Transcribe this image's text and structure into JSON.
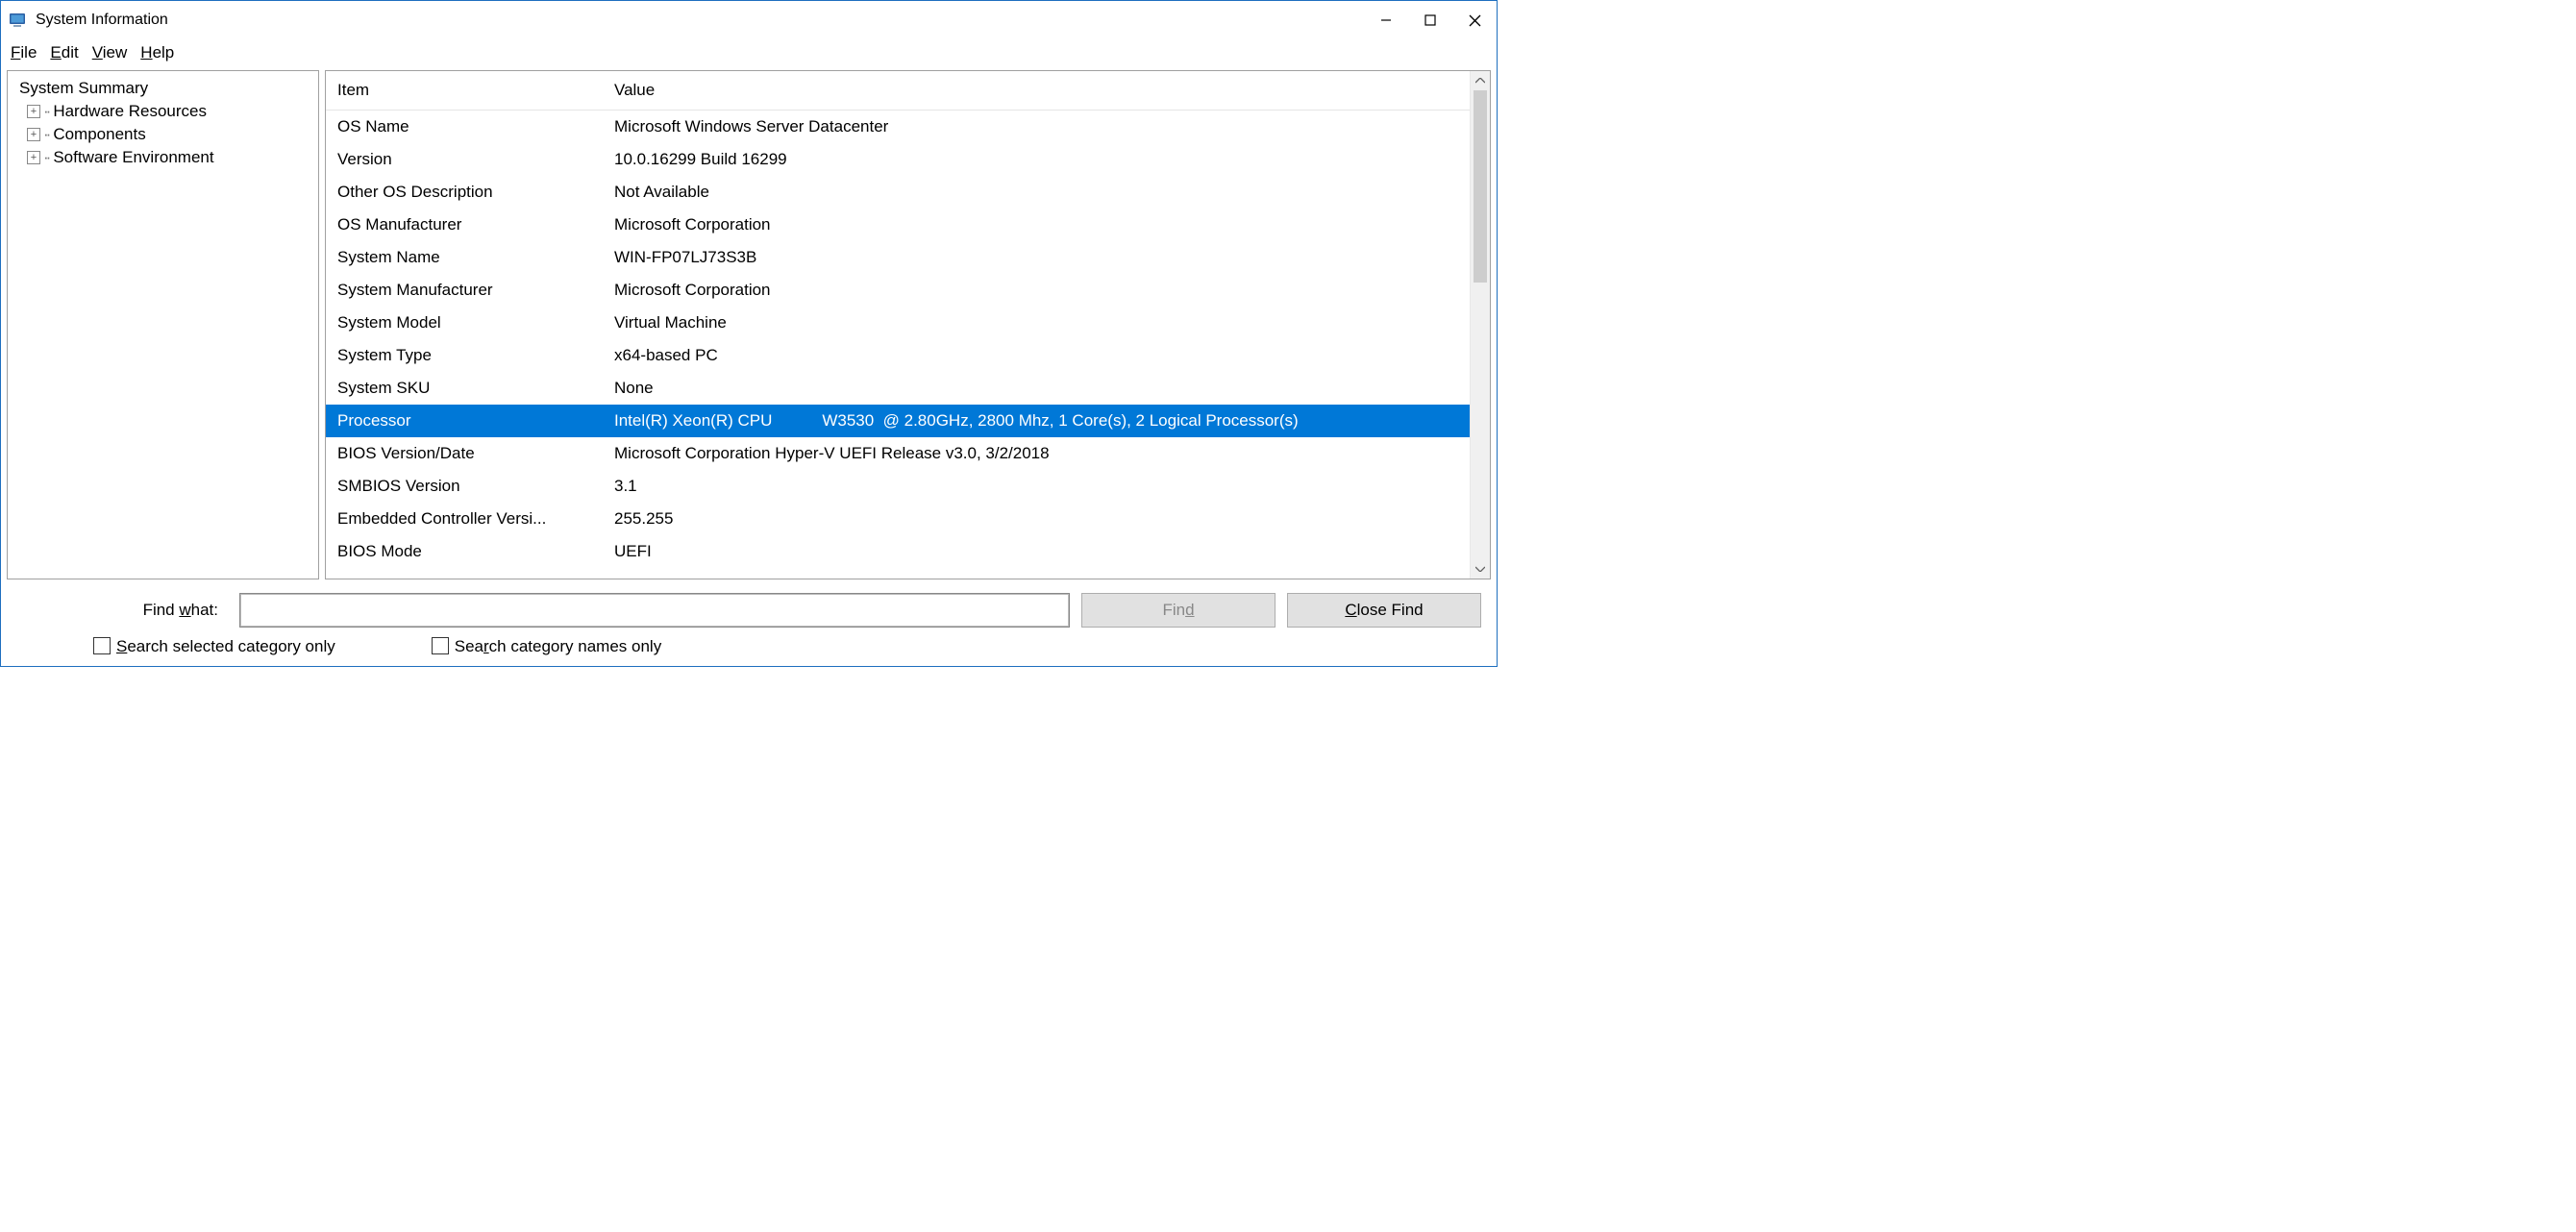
{
  "title": "System Information",
  "menu": {
    "file": "File",
    "edit": "Edit",
    "view": "View",
    "help": "Help"
  },
  "tree": {
    "root": "System Summary",
    "children": [
      "Hardware Resources",
      "Components",
      "Software Environment"
    ]
  },
  "list": {
    "headers": {
      "item": "Item",
      "value": "Value"
    },
    "rows": [
      {
        "item": "OS Name",
        "value": "Microsoft Windows Server Datacenter",
        "selected": false
      },
      {
        "item": "Version",
        "value": "10.0.16299 Build 16299",
        "selected": false
      },
      {
        "item": "Other OS Description",
        "value": "Not Available",
        "selected": false
      },
      {
        "item": "OS Manufacturer",
        "value": "Microsoft Corporation",
        "selected": false
      },
      {
        "item": "System Name",
        "value": "WIN-FP07LJ73S3B",
        "selected": false
      },
      {
        "item": "System Manufacturer",
        "value": "Microsoft Corporation",
        "selected": false
      },
      {
        "item": "System Model",
        "value": "Virtual Machine",
        "selected": false
      },
      {
        "item": "System Type",
        "value": "x64-based PC",
        "selected": false
      },
      {
        "item": "System SKU",
        "value": "None",
        "selected": false
      },
      {
        "item": "Processor",
        "value": "Intel(R) Xeon(R) CPU           W3530  @ 2.80GHz, 2800 Mhz, 1 Core(s), 2 Logical Processor(s)",
        "selected": true
      },
      {
        "item": "BIOS Version/Date",
        "value": "Microsoft Corporation Hyper-V UEFI Release v3.0, 3/2/2018",
        "selected": false
      },
      {
        "item": "SMBIOS Version",
        "value": "3.1",
        "selected": false
      },
      {
        "item": "Embedded Controller Versi...",
        "value": "255.255",
        "selected": false
      },
      {
        "item": "BIOS Mode",
        "value": "UEFI",
        "selected": false
      }
    ]
  },
  "find": {
    "label": "Find what:",
    "value": "",
    "find_btn": "Find",
    "close_btn": "Close Find",
    "opt1": "Search selected category only",
    "opt2": "Search category names only"
  }
}
